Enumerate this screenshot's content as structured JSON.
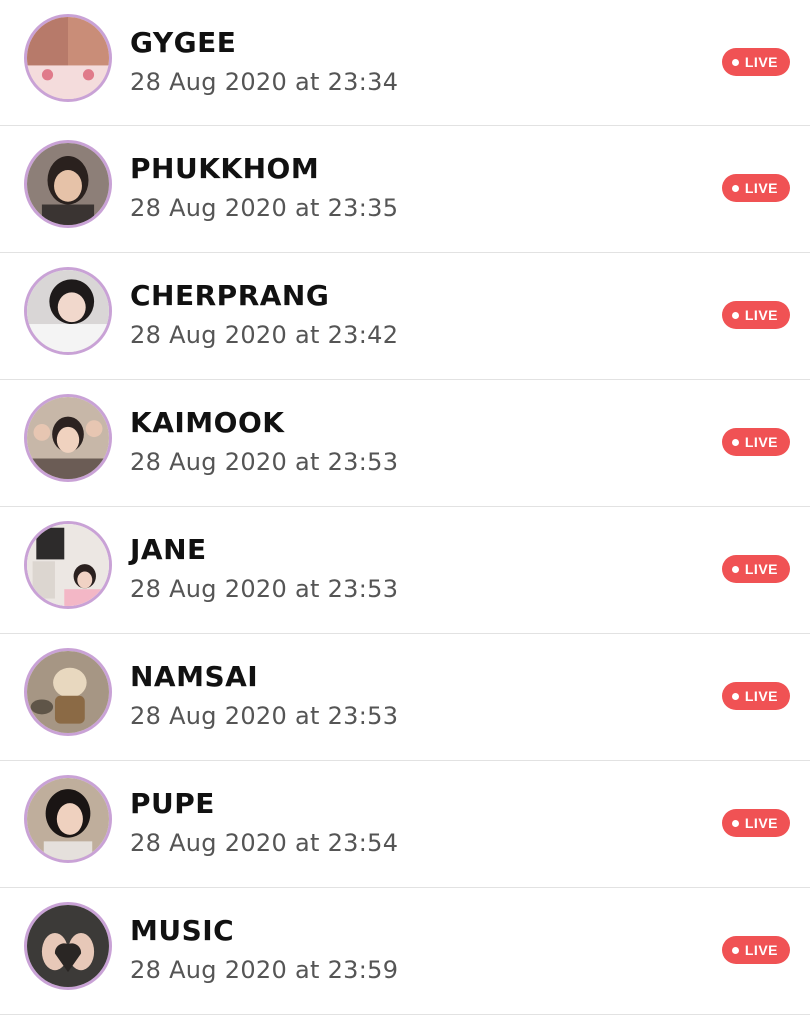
{
  "live_list": {
    "badge_label": "LIVE",
    "accent_color": "#f05254",
    "avatar_ring_color": "#c9a2d6",
    "items": [
      {
        "name": "GYGEE",
        "time": "28 Aug 2020 at 23:34"
      },
      {
        "name": "PHUKKHOM",
        "time": "28 Aug 2020 at 23:35"
      },
      {
        "name": "CHERPRANG",
        "time": "28 Aug 2020 at 23:42"
      },
      {
        "name": "KAIMOOK",
        "time": "28 Aug 2020 at 23:53"
      },
      {
        "name": "JANE",
        "time": "28 Aug 2020 at 23:53"
      },
      {
        "name": "NAMSAI",
        "time": "28 Aug 2020 at 23:53"
      },
      {
        "name": "PUPE",
        "time": "28 Aug 2020 at 23:54"
      },
      {
        "name": "MUSIC",
        "time": "28 Aug 2020 at 23:59"
      }
    ]
  }
}
